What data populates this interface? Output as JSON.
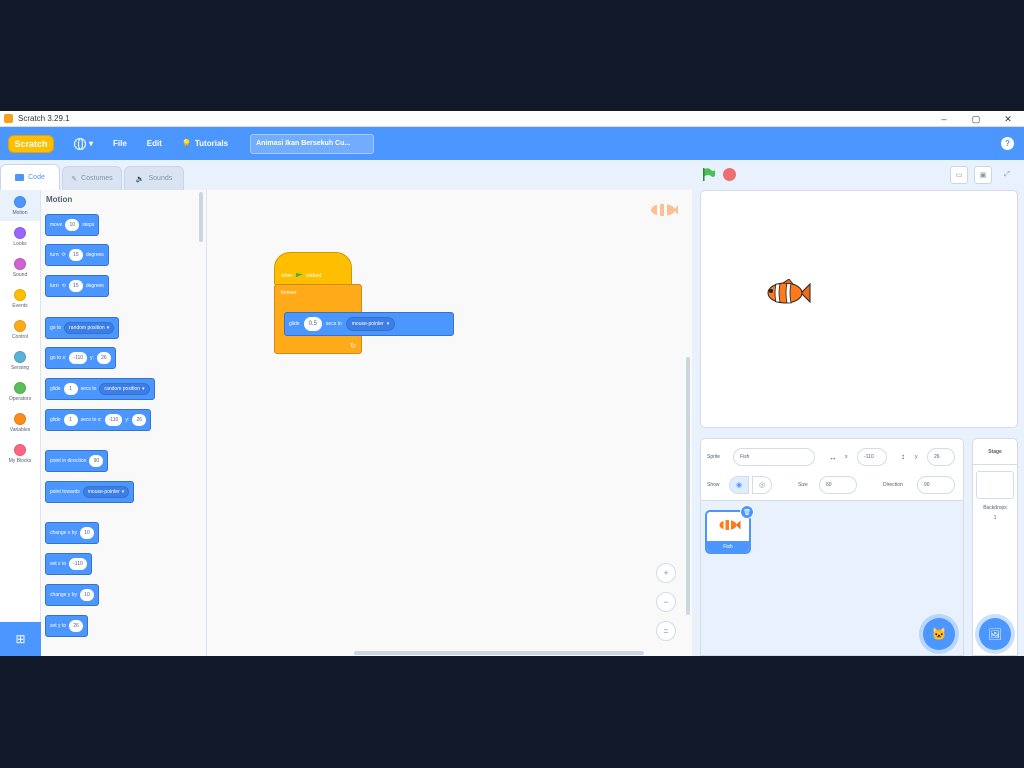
{
  "window": {
    "title": "Scratch 3.29.1",
    "controls": [
      "–",
      "▢",
      "✕"
    ]
  },
  "menubar": {
    "logo": "Scratch",
    "file": "File",
    "edit": "Edit",
    "tutorials": "Tutorials",
    "project_title": "Animasi Ikan Bersekuh Cu...",
    "help": "?"
  },
  "tabs": {
    "code": "Code",
    "costumes": "Costumes",
    "sounds": "Sounds"
  },
  "categories": [
    {
      "label": "Motion",
      "color": "#4c97ff"
    },
    {
      "label": "Looks",
      "color": "#9966ff"
    },
    {
      "label": "Sound",
      "color": "#cf63cf"
    },
    {
      "label": "Events",
      "color": "#ffbf00"
    },
    {
      "label": "Control",
      "color": "#ffab19"
    },
    {
      "label": "Sensing",
      "color": "#5cb1d6"
    },
    {
      "label": "Operators",
      "color": "#59c059"
    },
    {
      "label": "Variables",
      "color": "#ff8c1a"
    },
    {
      "label": "My Blocks",
      "color": "#ff6680"
    }
  ],
  "palette": {
    "section": "Motion",
    "blocks": {
      "move": {
        "t1": "move",
        "v": "10",
        "t2": "steps"
      },
      "turn_right": {
        "t1": "turn",
        "icon": "⟳",
        "v": "15",
        "t2": "degrees"
      },
      "turn_left": {
        "t1": "turn",
        "icon": "⟲",
        "v": "15",
        "t2": "degrees"
      },
      "goto": {
        "t1": "go to",
        "d": "random position"
      },
      "gotoxy": {
        "t1": "go to x:",
        "x": "-110",
        "t2": "y:",
        "y": "26"
      },
      "glide_to": {
        "t1": "glide",
        "v": "1",
        "t2": "secs to",
        "d": "random position"
      },
      "glide_xy": {
        "t1": "glide",
        "v": "1",
        "t2": "secs to x:",
        "x": "-110",
        "t3": "y:",
        "y": "26"
      },
      "point_dir": {
        "t1": "point in direction",
        "v": "90"
      },
      "point_towards": {
        "t1": "point towards",
        "d": "mouse-pointer"
      },
      "change_x": {
        "t1": "change x by",
        "v": "10"
      },
      "set_x": {
        "t1": "set x to",
        "v": "-110"
      },
      "change_y": {
        "t1": "change y by",
        "v": "10"
      },
      "set_y": {
        "t1": "set y to",
        "v": "26"
      }
    }
  },
  "script": {
    "hat": {
      "t1": "when",
      "t2": "clicked"
    },
    "forever": "forever",
    "glide": {
      "t1": "glide",
      "v": "0.5",
      "t2": "secs to",
      "d": "mouse-pointer"
    }
  },
  "zoom": {
    "in": "+",
    "out": "−",
    "reset": "="
  },
  "sprite_info": {
    "sprite_label": "Sprite",
    "sprite_name": "Fish",
    "x_label": "x",
    "x": "-110",
    "y_label": "y",
    "y": "26",
    "show_label": "Show",
    "size_label": "Size",
    "size": "60",
    "direction_label": "Direction",
    "direction": "90"
  },
  "sprite_list": [
    {
      "name": "Fish"
    }
  ],
  "stage_pane": {
    "title": "Stage",
    "backdrops_label": "Backdrops",
    "backdrops_count": "1"
  },
  "colors": {
    "motion": "#4c97ff",
    "events": "#ffbf00",
    "control": "#ffab19",
    "menubar": "#4c97ff"
  }
}
